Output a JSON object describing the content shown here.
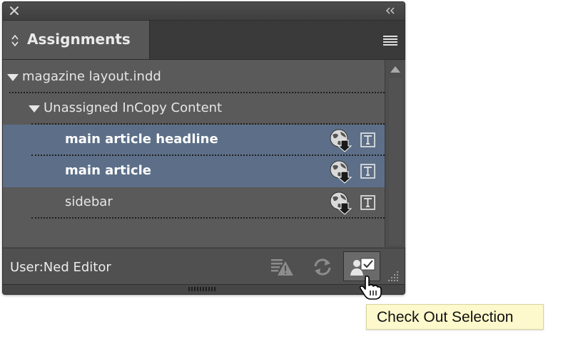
{
  "panel": {
    "tab_title": "Assignments",
    "tree": {
      "document": {
        "label": "magazine layout.indd",
        "expanded": true
      },
      "group": {
        "label": "Unassigned InCopy Content",
        "expanded": true
      },
      "items": [
        {
          "label": "main article headline",
          "selected": true
        },
        {
          "label": "main article",
          "selected": true
        },
        {
          "label": "sidebar",
          "selected": false
        }
      ]
    },
    "footer": {
      "user_label": "User:Ned Editor"
    }
  },
  "tooltip": {
    "text": "Check Out Selection"
  },
  "colors": {
    "panel_bg": "#5a5a5a",
    "selection": "#5d6f88",
    "tooltip_bg": "#fdf9cc"
  },
  "icons": [
    "close-icon",
    "collapse-icon",
    "tab-arrows-icon",
    "panel-menu-icon",
    "disclosure-triangle-icon",
    "globe-download-icon",
    "text-frame-icon",
    "missing-warning-icon",
    "update-refresh-icon",
    "check-out-icon",
    "resize-grip-icon",
    "pointer-hand-icon"
  ]
}
